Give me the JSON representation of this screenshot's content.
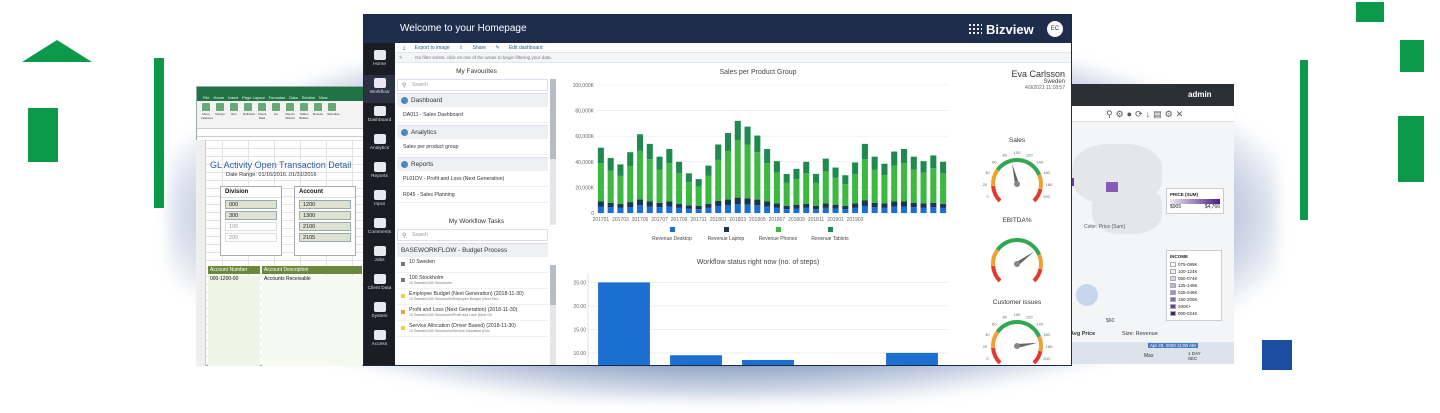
{
  "main": {
    "title": "Welcome to your Homepage",
    "brand": "Bizview",
    "avatar": "EC",
    "actions": [
      "Export to image",
      "Share",
      "Edit dashboard"
    ],
    "filter_text": "No filter exists, click on one of the areas to begin filtering your data.",
    "sidebar": [
      "Home",
      "Workflow",
      "Dashboard",
      "Analytics",
      "Reports",
      "Input",
      "Comments",
      "Jobs",
      "Client Data",
      "System",
      "Access"
    ],
    "favourites": {
      "title": "My Favourites",
      "search_placeholder": "Search",
      "sections": [
        {
          "label": "Dashboard",
          "items": [
            "DA011 - Sales Dashboard"
          ]
        },
        {
          "label": "Analytics",
          "items": [
            "Sales per product group"
          ]
        },
        {
          "label": "Reports",
          "items": [
            "PL01DV - Profit and Loss (Next Generation)",
            "R045 - Sales Planning"
          ]
        }
      ]
    },
    "tasks": {
      "title": "My Workflow Tasks",
      "search_placeholder": "Search",
      "header": "BASEWORKFLOW - Budget Process",
      "items": [
        {
          "label": "10 Sweden",
          "sub": ""
        },
        {
          "label": "100 Stockholm",
          "sub": "10 Sweden\\100 Stockholm"
        },
        {
          "label": "Employee Budget (Next Generation) (2018-11-30)",
          "sub": "10 Sweden\\100 Stockholm\\Employee Budget (Next Gen"
        },
        {
          "label": "Profit and Loss (Next Generation) (2018-11-30)",
          "sub": "10 Sweden\\100 Stockholm\\Profit and Loss (Next Ge"
        },
        {
          "label": "Service Allocation (Driver Based) (2018-11-30)",
          "sub": "10 Sweden\\100 Stockholm\\Service Allocation (Driv"
        }
      ]
    },
    "person": {
      "name": "Eva Carlsson",
      "country": "Sweden",
      "date": "4/9/2021 11:18:57"
    },
    "gauges": [
      {
        "title": "Sales",
        "ticks": [
          "-20",
          "0",
          "20",
          "40",
          "60",
          "80",
          "100",
          "120",
          "140",
          "160",
          "180",
          "200",
          "220"
        ],
        "value_fraction": 0.45
      },
      {
        "title": "EBITDA%",
        "ticks": [],
        "value_fraction": 0.7
      },
      {
        "title": "Customer issues",
        "ticks": [
          "-20",
          "0",
          "20",
          "40",
          "60",
          "80",
          "100",
          "120",
          "140",
          "160",
          "180",
          "200",
          "220"
        ],
        "value_fraction": 0.8
      }
    ]
  },
  "chart_data": [
    {
      "type": "bar",
      "title": "Sales per Product Group",
      "stacked": true,
      "categories": [
        "201701",
        "201702",
        "201703",
        "201704",
        "201705",
        "201706",
        "201707",
        "201708",
        "201709",
        "201710",
        "201711",
        "201712",
        "201801",
        "201802",
        "201803",
        "201804",
        "201805",
        "201806",
        "201807",
        "201808",
        "201809",
        "201810",
        "201811",
        "201812",
        "201901",
        "201902",
        "201903",
        "201904",
        "201905",
        "201906",
        "201907",
        "201908",
        "201909",
        "201910",
        "201911",
        "201912"
      ],
      "x_tick_labels": [
        "201701",
        "201703",
        "201705",
        "201707",
        "201709",
        "201711",
        "201801",
        "201803",
        "201805",
        "201807",
        "201809",
        "201811",
        "201901",
        "201903"
      ],
      "ylim": [
        0,
        100000
      ],
      "y_ticks": [
        "0",
        "20,000K",
        "40,000K",
        "60,000K",
        "80,000K",
        "100,000K"
      ],
      "series": [
        {
          "name": "Revenue Desktop",
          "color": "#1a6fd0",
          "values": [
            5000,
            4500,
            4000,
            4500,
            6000,
            5000,
            4500,
            5000,
            4000,
            3500,
            3000,
            4000,
            5500,
            6000,
            7000,
            6500,
            6000,
            5000,
            4000,
            3000,
            3500,
            4000,
            3000,
            4000,
            3500,
            3000,
            4000,
            5500,
            4500,
            4000,
            5000,
            5000,
            4500,
            4000,
            4500,
            4000
          ]
        },
        {
          "name": "Revenue Laptop",
          "color": "#1a3552",
          "values": [
            4000,
            3500,
            3000,
            4000,
            4500,
            4000,
            3500,
            4000,
            3000,
            2500,
            2500,
            3000,
            4000,
            4500,
            5000,
            5000,
            4500,
            4000,
            3500,
            2500,
            3000,
            3000,
            2500,
            3500,
            3000,
            2500,
            3500,
            4500,
            3500,
            3500,
            4000,
            4000,
            3500,
            3500,
            3500,
            3000
          ]
        },
        {
          "name": "Revenue Phones",
          "color": "#3db840",
          "values": [
            30000,
            25000,
            22000,
            28000,
            38000,
            33000,
            26000,
            30000,
            24000,
            18000,
            15000,
            22000,
            32000,
            38000,
            45000,
            42000,
            37000,
            30000,
            24000,
            18000,
            20000,
            24000,
            18000,
            25000,
            21000,
            17000,
            23000,
            32000,
            26000,
            22000,
            28000,
            30000,
            26000,
            24000,
            27000,
            24000
          ]
        },
        {
          "name": "Revenue Tablets",
          "color": "#1e8a50",
          "values": [
            12000,
            10000,
            9000,
            11000,
            13000,
            12000,
            10000,
            11000,
            9000,
            7000,
            6000,
            8000,
            12000,
            14000,
            15000,
            14000,
            13000,
            11000,
            9000,
            7000,
            8000,
            9000,
            7000,
            10000,
            8000,
            7000,
            9000,
            12000,
            10000,
            9000,
            11000,
            11000,
            10000,
            9000,
            10000,
            9000
          ]
        }
      ]
    },
    {
      "type": "bar",
      "title": "Workflow status right now (no. of steps)",
      "y_ticks": [
        "10.00",
        "15.00",
        "20.00",
        "25.00"
      ],
      "ylim": [
        7,
        27
      ],
      "categories": [
        "",
        "",
        "",
        "",
        ""
      ],
      "values": [
        25,
        9.5,
        8.5,
        0,
        10
      ],
      "color": "#1a6fd0"
    }
  ],
  "excel": {
    "tabs": [
      "File",
      "Home",
      "Insert",
      "Page Layout",
      "Formulas",
      "Data",
      "Review",
      "View"
    ],
    "ribbon": [
      "Menu Features",
      "Design",
      "Run",
      "Drilldown",
      "Check Data",
      "Go",
      "Report Wizard",
      "Tables Builder",
      "Browse",
      "Schedule"
    ],
    "title": "GL Activity Open Transaction Detail",
    "date_range_label": "Date Range:",
    "date_range": "01/16/2016..01/31/2016",
    "division": {
      "label": "Division",
      "items": [
        "000",
        "300",
        "100",
        "200"
      ]
    },
    "account": {
      "label": "Account",
      "items": [
        "1200",
        "1300",
        "2100",
        "2105"
      ]
    },
    "columns": [
      "Account Number",
      "Account Description"
    ],
    "row": [
      "000-1200-00",
      "Accounts Receivable"
    ]
  },
  "mapwin": {
    "user": "admin",
    "price_legend": {
      "title": "PRICE (SUM)",
      "min": "$905",
      "max": "$4,766"
    },
    "color_label": "Color: Price (Sum)",
    "income_legend": {
      "title": "INCOME",
      "items": [
        "075-099K",
        "100-124K",
        "050-074K",
        "125-149K",
        "025-049K",
        "150-200K",
        "200K+",
        "000-024K"
      ]
    },
    "avg_price": "Avg Price",
    "size_label": "Size: Revenue",
    "axis_value": "$60",
    "bottom_date": "Apr 29, 2020 11:00 AM",
    "max_label": "Max",
    "day_label": "1 DAY SEC"
  }
}
